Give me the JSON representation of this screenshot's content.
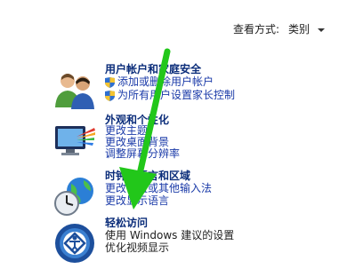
{
  "view": {
    "label": "查看方式:",
    "selected": "类别"
  },
  "categories": [
    {
      "title": "用户帐户和家庭安全",
      "links": [
        "添加或删除用户帐户",
        "为所有用户设置家长控制"
      ]
    },
    {
      "title": "外观和个性化",
      "links": [
        "更改主题",
        "更改桌面背景",
        "调整屏幕分辨率"
      ]
    },
    {
      "title": "时钟、语言和区域",
      "links": [
        "更改键盘或其他输入法",
        "更改显示语言"
      ]
    },
    {
      "title": "轻松访问",
      "links": [
        "使用 Windows 建议的设置",
        "优化视频显示"
      ]
    }
  ],
  "colors": {
    "arrow": "#22c71a",
    "title": "#0b2d7a",
    "link": "#1a3aa8"
  }
}
